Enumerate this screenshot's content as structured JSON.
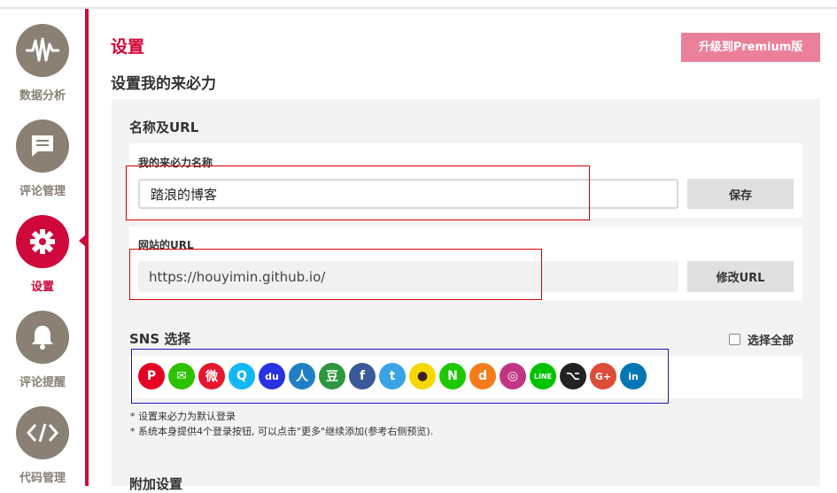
{
  "sidebar": {
    "items": [
      {
        "label": "数据分析",
        "icon": "analytics-waveform-icon",
        "active": false
      },
      {
        "label": "评论管理",
        "icon": "comment-icon",
        "active": false
      },
      {
        "label": "设置",
        "icon": "gear-icon",
        "active": true
      },
      {
        "label": "评论提醒",
        "icon": "bell-icon",
        "active": false
      },
      {
        "label": "代码管理",
        "icon": "code-icon",
        "active": false
      }
    ],
    "accent": "#d0073a",
    "inactive_color": "#8a8074"
  },
  "header": {
    "title": "设置",
    "premium_button": "升级到Premium版",
    "subtitle": "设置我的来必力"
  },
  "name_url": {
    "section_title": "名称及URL",
    "name_label": "我的来必力名称",
    "name_value": "踏浪的博客",
    "save_button": "保存",
    "url_label": "网站的URL",
    "url_value": "https://houyimin.github.io/",
    "modify_button": "修改URL"
  },
  "sns": {
    "section_title": "SNS 选择",
    "select_all_label": "选择全部",
    "icons": [
      {
        "name": "pinterest-icon",
        "glyph": "P",
        "color": "#e60023"
      },
      {
        "name": "wechat-icon",
        "glyph": "✉",
        "color": "#2dc100"
      },
      {
        "name": "weibo-icon",
        "glyph": "微",
        "color": "#e6162d"
      },
      {
        "name": "qq-icon",
        "glyph": "Q",
        "color": "#12b7f5"
      },
      {
        "name": "baidu-icon",
        "glyph": "du",
        "color": "#2932e1"
      },
      {
        "name": "renren-icon",
        "glyph": "人",
        "color": "#1f7fc4"
      },
      {
        "name": "douban-icon",
        "glyph": "豆",
        "color": "#2e963d"
      },
      {
        "name": "facebook-icon",
        "glyph": "f",
        "color": "#3b5998"
      },
      {
        "name": "twitter-icon",
        "glyph": "t",
        "color": "#3aa3e3"
      },
      {
        "name": "kakaotalk-icon",
        "glyph": "●",
        "color": "#f5d800"
      },
      {
        "name": "naver-icon",
        "glyph": "N",
        "color": "#1ec800"
      },
      {
        "name": "daum-icon",
        "glyph": "d",
        "color": "#f47c1a"
      },
      {
        "name": "instagram-icon",
        "glyph": "◎",
        "color": "#c13584"
      },
      {
        "name": "line-icon",
        "glyph": "LINE",
        "color": "#00c300"
      },
      {
        "name": "github-icon",
        "glyph": "⌥",
        "color": "#222222"
      },
      {
        "name": "googleplus-icon",
        "glyph": "G+",
        "color": "#dd4b39"
      },
      {
        "name": "linkedin-icon",
        "glyph": "in",
        "color": "#0077b5"
      }
    ],
    "notes": [
      "* 设置来必力为默认登录",
      "* 系统本身提供4个登录按钮, 可以点击\"更多\"继续添加(参考右侧预览)."
    ]
  },
  "extra": {
    "section_title": "附加设置"
  }
}
